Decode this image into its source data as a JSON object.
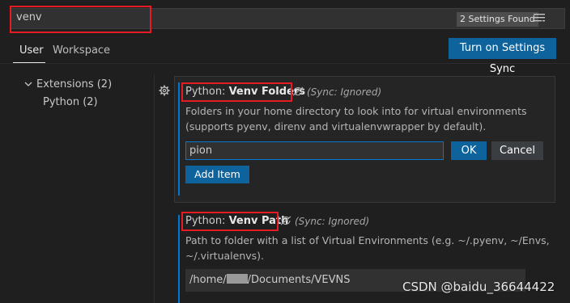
{
  "search": {
    "value": "venv",
    "results_badge": "2 Settings Found"
  },
  "tabs": [
    {
      "label": "User",
      "active": true
    },
    {
      "label": "Workspace",
      "active": false
    }
  ],
  "sync_button": "Turn on Settings Sync",
  "toc": {
    "group": "Extensions (2)",
    "child": "Python (2)"
  },
  "settings": [
    {
      "category": "Python: ",
      "name": "Venv Folders",
      "sync_note": "(Sync: Ignored)",
      "description": "Folders in your home directory to look into for virtual environments (supports pyenv, direnv and virtualenvwrapper by default).",
      "edit_value": "pion",
      "ok_label": "OK",
      "cancel_label": "Cancel",
      "add_label": "Add Item"
    },
    {
      "category": "Python: ",
      "name": "Venv Path",
      "sync_note": "(Sync: Ignored)",
      "description": "Path to folder with a list of Virtual Environments (e.g. ~/.pyenv, ~/Envs, ~/.virtualenvs).",
      "value_prefix": "/home/",
      "value_suffix": "/Documents/VEVNS"
    }
  ],
  "watermark": "CSDN @baidu_36644422",
  "colors": {
    "background": "#1f1f1f",
    "accent_blue": "#0e639c",
    "focus_border": "#0078d4",
    "highlight_red": "#e51c23"
  }
}
